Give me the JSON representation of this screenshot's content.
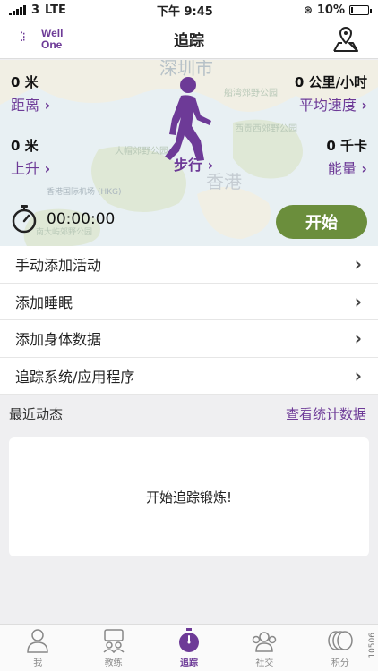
{
  "status": {
    "carrier": "3",
    "network": "LTE",
    "time": "下午 9:45",
    "battery": "10%",
    "battery_level": 0.1
  },
  "nav": {
    "logo_line1": "Well",
    "logo_line2": "One",
    "title": "追踪"
  },
  "map": {
    "city_label": "深圳市",
    "hk_label": "香港",
    "park1": "船湾郊野公园",
    "park2": "西贡西郊野公园",
    "park3": "大帽郊野公园",
    "airport": "香港国际机场 (HKG)",
    "park4": "南大屿郊野公园"
  },
  "stats": {
    "distance_value": "0 米",
    "distance_label": "距离",
    "speed_value": "0 公里/小时",
    "speed_label": "平均速度",
    "ascent_value": "0 米",
    "ascent_label": "上升",
    "energy_value": "0 千卡",
    "energy_label": "能量"
  },
  "activity": {
    "mode": "步行",
    "timer": "00:00:00",
    "start": "开始"
  },
  "menu": [
    {
      "label": "手动添加活动"
    },
    {
      "label": "添加睡眠"
    },
    {
      "label": "添加身体数据"
    },
    {
      "label": "追踪系统/应用程序"
    }
  ],
  "recent": {
    "title": "最近动态",
    "link": "查看统计数据",
    "empty": "开始追踪锻炼!"
  },
  "tabs": [
    {
      "label": "我",
      "icon": "person-icon"
    },
    {
      "label": "教练",
      "icon": "coach-icon"
    },
    {
      "label": "追踪",
      "icon": "stopwatch-icon"
    },
    {
      "label": "社交",
      "icon": "group-icon"
    },
    {
      "label": "积分",
      "icon": "coins-icon"
    }
  ],
  "version": "10506",
  "colors": {
    "accent": "#6d3a97",
    "start_button": "#6b8e3c"
  }
}
